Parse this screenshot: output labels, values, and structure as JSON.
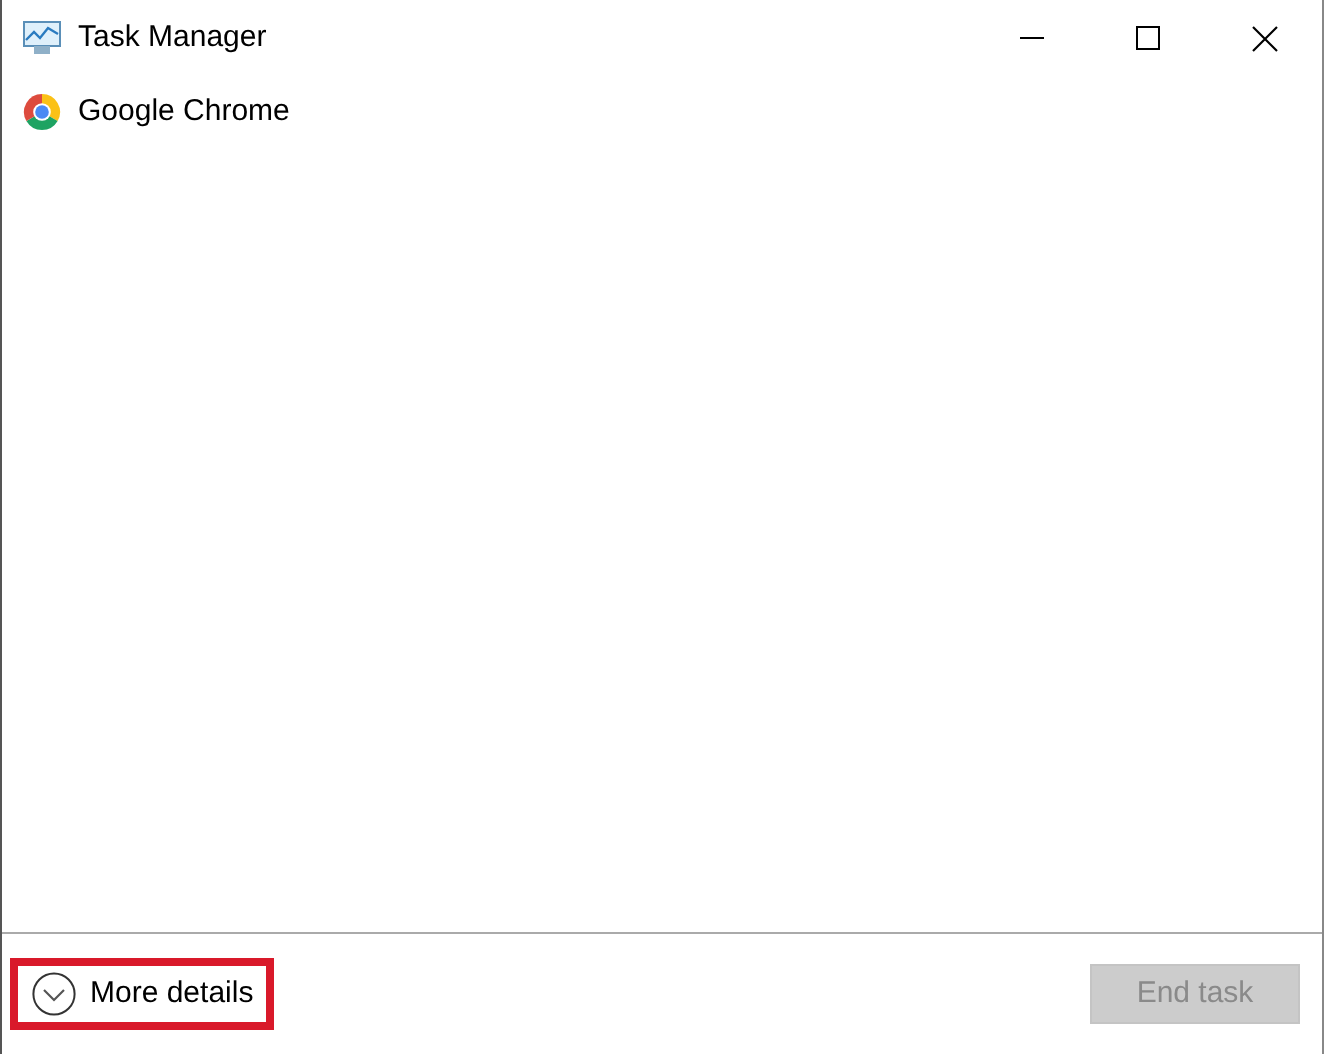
{
  "window": {
    "title": "Task Manager"
  },
  "processes": [
    {
      "name": "Google Chrome"
    }
  ],
  "footer": {
    "more_details": {
      "label": "More details",
      "expanded": false,
      "highlighted": true
    },
    "end_task": {
      "label": "End task",
      "disabled": true
    }
  }
}
